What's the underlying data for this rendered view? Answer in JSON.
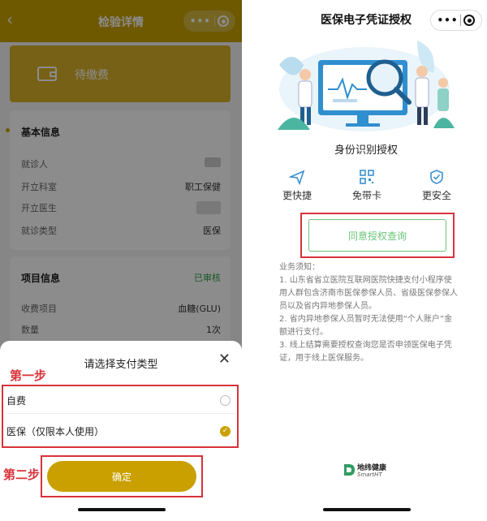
{
  "left": {
    "header": {
      "back_icon": "‹",
      "title": "检验详情",
      "more_icon": "•••"
    },
    "status": {
      "label": "待缴费"
    },
    "basic_info": {
      "heading": "基本信息",
      "rows": [
        {
          "label": "就诊人",
          "value": ""
        },
        {
          "label": "开立科室",
          "value": "职工保健"
        },
        {
          "label": "开立医生",
          "value": ""
        },
        {
          "label": "就诊类型",
          "value": "医保"
        }
      ]
    },
    "item_info": {
      "heading": "项目信息",
      "badge": "已审核",
      "rows": [
        {
          "label": "收费项目",
          "value": "血糖(GLU)"
        },
        {
          "label": "数量",
          "value": "1次"
        }
      ]
    },
    "sheet": {
      "title": "请选择支付类型",
      "close": "✕",
      "options": [
        {
          "label": "自费",
          "selected": false
        },
        {
          "label": "医保（仅限本人使用）",
          "selected": true
        }
      ],
      "confirm": "确定"
    },
    "annotations": {
      "step1": "第一步",
      "step2": "第二步"
    }
  },
  "right": {
    "header": {
      "title": "医保电子凭证授权",
      "more_icon": "•••"
    },
    "subtitle": "身份识别授权",
    "features": [
      "更快捷",
      "免带卡",
      "更安全"
    ],
    "auth_button": "同意授权查询",
    "notice": {
      "heading": "业务须知：",
      "items": [
        "1. 山东省省立医院互联网医院快捷支付小程序使用人群包含济南市医保参保人员、省级医保参保人员以及省内异地参保人员。",
        "2. 省内异地参保人员暂时无法使用“个人账户”金额进行支付。",
        "3. 线上结算需要授权查询您是否申领医保电子凭证，用于线上医保服务。"
      ]
    },
    "footer_logo": {
      "name": "地纬健康",
      "sub": "SmartHT"
    }
  },
  "colors": {
    "brand": "#c9a000",
    "annotation_red": "#d8323a",
    "green": "#6cc47a"
  }
}
